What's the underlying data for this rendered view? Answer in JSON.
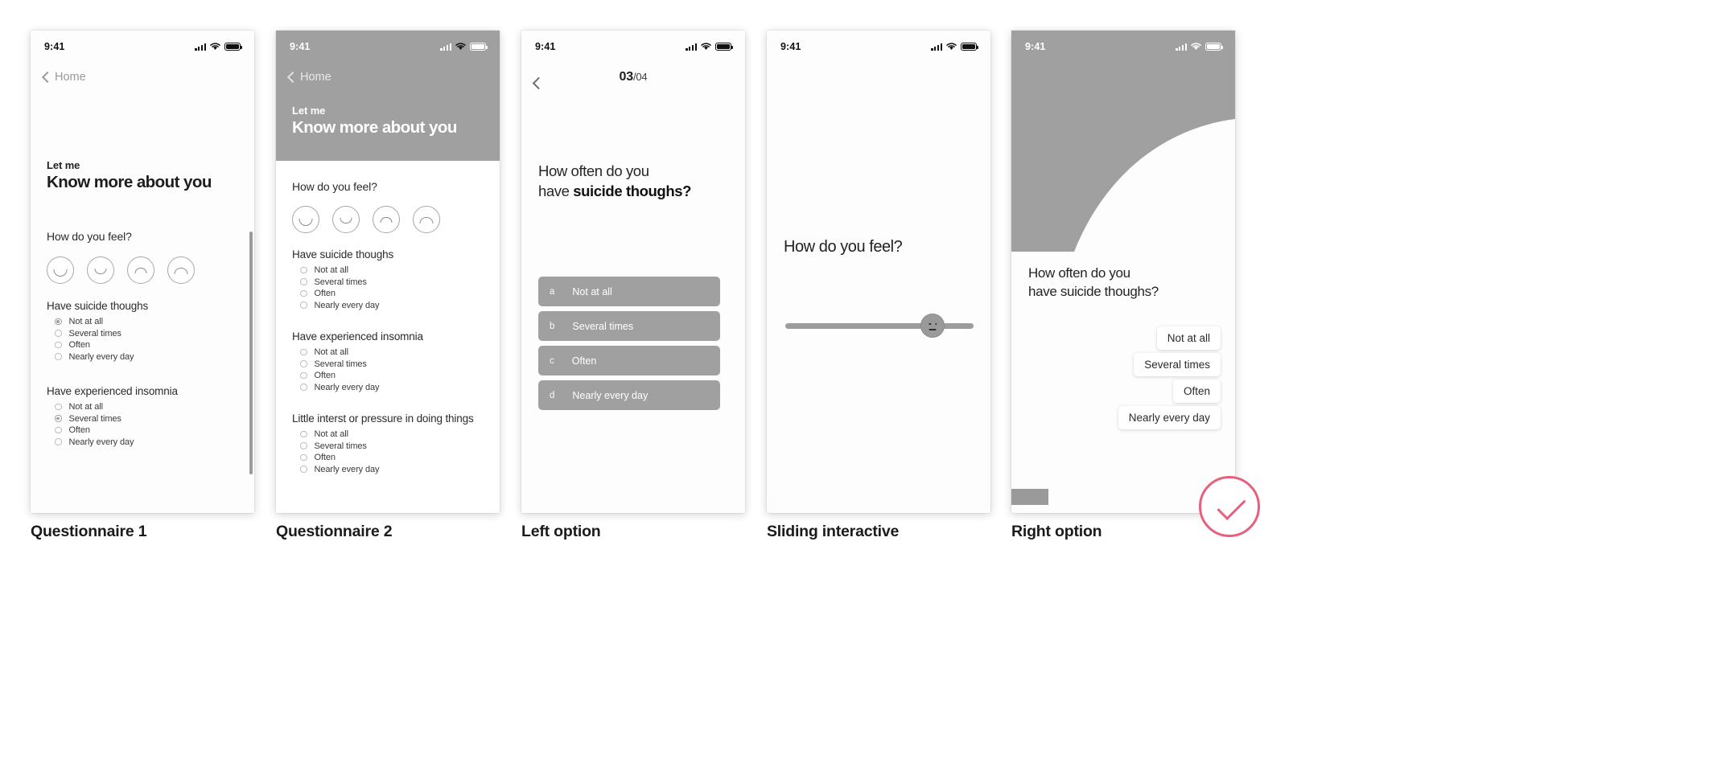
{
  "common": {
    "status_time": "9:41",
    "back_label": "Home",
    "options": [
      "Not at all",
      "Several times",
      "Often",
      "Nearly every day"
    ],
    "icons": {
      "signal": "signal-bars-icon",
      "wifi": "wifi-icon",
      "battery": "battery-icon",
      "back": "chevron-left-icon"
    },
    "faces": [
      "face-happy",
      "face-ok",
      "face-meh",
      "face-sad"
    ]
  },
  "screens": [
    {
      "caption": "Questionnaire 1",
      "eyebrow": "Let me",
      "title": "Know more about you",
      "feel_label": "How do you feel?",
      "sections": [
        {
          "title": "Have suicide thoughs",
          "selected": 0
        },
        {
          "title": "Have experienced insomnia",
          "selected": 1
        }
      ]
    },
    {
      "caption": "Questionnaire 2",
      "eyebrow": "Let me",
      "title": "Know more about you",
      "feel_label": "How do you feel?",
      "sections": [
        {
          "title": "Have suicide thoughs",
          "selected": -1
        },
        {
          "title": "Have experienced insomnia",
          "selected": -1
        },
        {
          "title": "Little interst or pressure in doing things",
          "selected": -1
        }
      ]
    },
    {
      "caption": "Left option",
      "pager_current": "03",
      "pager_total": "/04",
      "question_part1": "How often do you",
      "question_part2": "have ",
      "question_bold": "suicide thoughs?",
      "letters": [
        "a",
        "b",
        "c",
        "d"
      ]
    },
    {
      "caption": "Sliding interactive",
      "title": "How do you feel?",
      "slider_value": 72
    },
    {
      "caption": "Right option",
      "question_line1": "How often do you",
      "question_line2": "have suicide thoughs?"
    }
  ],
  "colors": {
    "gray": "#a0a0a0",
    "accent_pink": "#e8607f",
    "text": "#1d1d1d"
  }
}
